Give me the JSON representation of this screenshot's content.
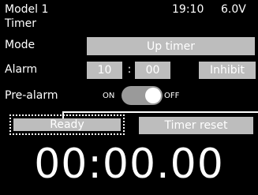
{
  "header": {
    "model_name": "Model 1",
    "clock": "19:10",
    "battery": "6.0V"
  },
  "screen_title": "Timer",
  "mode": {
    "label": "Mode",
    "value": "Up timer"
  },
  "alarm": {
    "label": "Alarm",
    "minutes": "10",
    "separator": ":",
    "seconds": "00",
    "inhibit_label": "Inhibit"
  },
  "prealarm": {
    "label": "Pre-alarm",
    "on_label": "ON",
    "off_label": "OFF",
    "state": "OFF"
  },
  "buttons": {
    "ready": "Ready",
    "timer_reset": "Timer reset"
  },
  "timer_display": "00:00.00",
  "colors": {
    "background": "#000000",
    "button": "#bdbdbd",
    "toggle_track": "#9a9a9a",
    "text": "#ffffff"
  }
}
